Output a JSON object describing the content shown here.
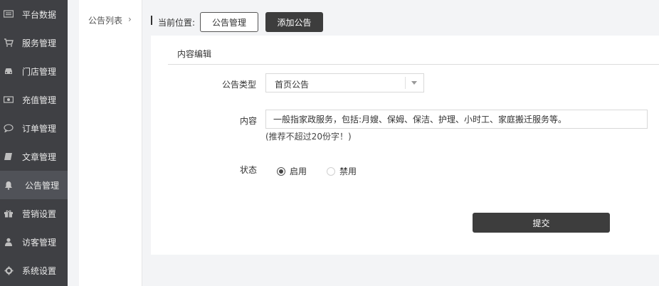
{
  "sidebar": {
    "items": [
      {
        "label": "平台数据",
        "icon": "monitor-icon"
      },
      {
        "label": "服务管理",
        "icon": "cart-icon"
      },
      {
        "label": "门店管理",
        "icon": "car-icon"
      },
      {
        "label": "充值管理",
        "icon": "banknote-icon"
      },
      {
        "label": "订单管理",
        "icon": "chat-bubble-icon"
      },
      {
        "label": "文章管理",
        "icon": "book-icon"
      },
      {
        "label": "公告管理",
        "icon": "bell-icon",
        "active": true
      },
      {
        "label": "营销设置",
        "icon": "gift-icon"
      },
      {
        "label": "访客管理",
        "icon": "user-icon"
      },
      {
        "label": "系统设置",
        "icon": "gear-icon"
      }
    ]
  },
  "submenu": {
    "item_label": "公告列表",
    "arrow": "›"
  },
  "location": {
    "label": "当前位置:",
    "current_button": "公告管理",
    "add_button": "添加公告"
  },
  "form": {
    "section_title": "内容编辑",
    "type_label": "公告类型",
    "type_value": "首页公告",
    "content_label": "内容",
    "content_value": "一般指家政服务，包括:月嫂、保姆、保洁、护理、小时工、家庭搬迁服务等。",
    "content_hint": "(推荐不超过20份字！)",
    "status_label": "状态",
    "status_options": [
      {
        "label": "启用",
        "checked": true
      },
      {
        "label": "禁用",
        "checked": false
      }
    ],
    "submit_label": "提交"
  }
}
